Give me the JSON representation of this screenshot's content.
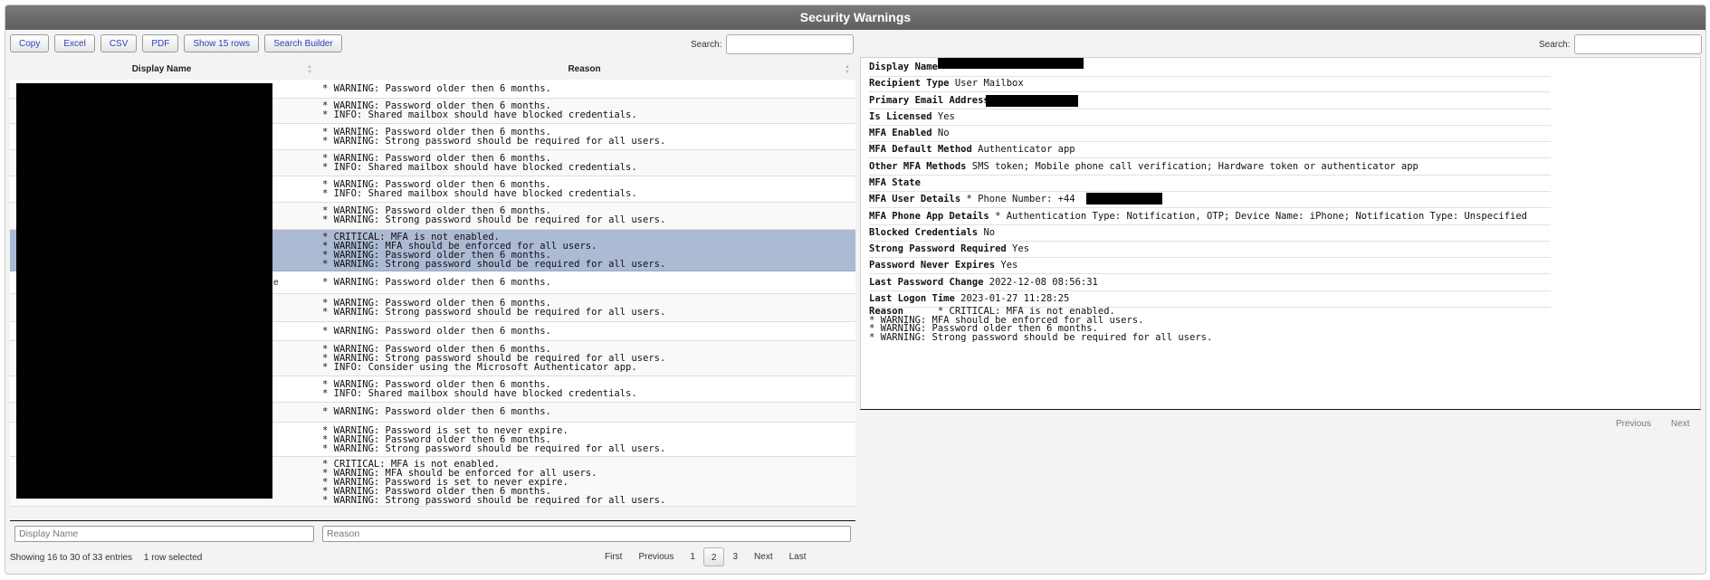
{
  "window": {
    "title": "Security Warnings"
  },
  "toolbar": {
    "buttons": [
      "Copy",
      "Excel",
      "CSV",
      "PDF",
      "Show 15 rows",
      "Search Builder"
    ]
  },
  "left_search": {
    "label": "Search:",
    "value": ""
  },
  "right_search": {
    "label": "Search:",
    "value": ""
  },
  "table": {
    "columns": [
      "Display Name",
      "Reason"
    ],
    "rows": [
      {
        "reason": "* WARNING: Password older then 6 months."
      },
      {
        "reason": "* WARNING: Password older then 6 months.\n* INFO: Shared mailbox should have blocked credentials."
      },
      {
        "reason": "* WARNING: Password older then 6 months.\n* WARNING: Strong password should be required for all users."
      },
      {
        "reason": "* WARNING: Password older then 6 months.\n* INFO: Shared mailbox should have blocked credentials."
      },
      {
        "reason": "* WARNING: Password older then 6 months.\n* INFO: Shared mailbox should have blocked credentials."
      },
      {
        "reason": "* WARNING: Password older then 6 months.\n* WARNING: Strong password should be required for all users."
      },
      {
        "reason": "* CRITICAL: MFA is not enabled.\n* WARNING: MFA should be enforced for all users.\n* WARNING: Password older then 6 months.\n* WARNING: Strong password should be required for all users.",
        "selected": true
      },
      {
        "reason": "* WARNING: Password older then 6 months.",
        "name_fragment": "e"
      },
      {
        "reason": "* WARNING: Password older then 6 months.\n* WARNING: Strong password should be required for all users."
      },
      {
        "reason": "* WARNING: Password older then 6 months."
      },
      {
        "reason": "* WARNING: Password older then 6 months.\n* WARNING: Strong password should be required for all users.\n* INFO: Consider using the Microsoft Authenticator app."
      },
      {
        "reason": "* WARNING: Password older then 6 months.\n* INFO: Shared mailbox should have blocked credentials."
      },
      {
        "reason": "* WARNING: Password older then 6 months."
      },
      {
        "reason": "* WARNING: Password is set to never expire.\n* WARNING: Password older then 6 months.\n* WARNING: Strong password should be required for all users."
      },
      {
        "reason": "* CRITICAL: MFA is not enabled.\n* WARNING: MFA should be enforced for all users.\n* WARNING: Password is set to never expire.\n* WARNING: Password older then 6 months.\n* WARNING: Strong password should be required for all users."
      }
    ],
    "filters": {
      "display_name_placeholder": "Display Name",
      "reason_placeholder": "Reason"
    },
    "info": "Showing 16 to 30 of 33 entries",
    "selected_info": "1 row selected",
    "pagination": [
      "First",
      "Previous",
      "1",
      "2",
      "3",
      "Next",
      "Last"
    ],
    "current_page": "2"
  },
  "detail": {
    "fields": [
      {
        "key": "Display Name",
        "value": ""
      },
      {
        "key": "Recipient Type",
        "value": "User Mailbox"
      },
      {
        "key": "Primary Email Address",
        "value": ""
      },
      {
        "key": "Is Licensed",
        "value": "Yes"
      },
      {
        "key": "MFA Enabled",
        "value": "No"
      },
      {
        "key": "MFA Default Method",
        "value": "Authenticator app"
      },
      {
        "key": "Other MFA Methods",
        "value": "SMS token; Mobile phone call verification; Hardware token or authenticator app"
      },
      {
        "key": "MFA State",
        "value": ""
      },
      {
        "key": "MFA User Details",
        "value": "* Phone Number: +44"
      },
      {
        "key": "MFA Phone App Details",
        "value": "* Authentication Type: Notification, OTP; Device Name: iPhone; Notification Type: Unspecified"
      },
      {
        "key": "Blocked Credentials",
        "value": "No"
      },
      {
        "key": "Strong Password Required",
        "value": "Yes"
      },
      {
        "key": "Password Never Expires",
        "value": "Yes"
      },
      {
        "key": "Last Password Change",
        "value": "2022-12-08 08:56:31"
      },
      {
        "key": "Last Logon Time",
        "value": "2023-01-27 11:28:25"
      }
    ],
    "reason_key": "Reason",
    "reason_value": "* CRITICAL: MFA is not enabled.\n* WARNING: MFA should be enforced for all users.\n* WARNING: Password older then 6 months.\n* WARNING: Strong password should be required for all users.",
    "pagination": [
      "Previous",
      "Next"
    ]
  },
  "colors": {
    "title_bar": "#666666",
    "selected_row": "#acbad3",
    "button_text": "#2a3fb8"
  }
}
